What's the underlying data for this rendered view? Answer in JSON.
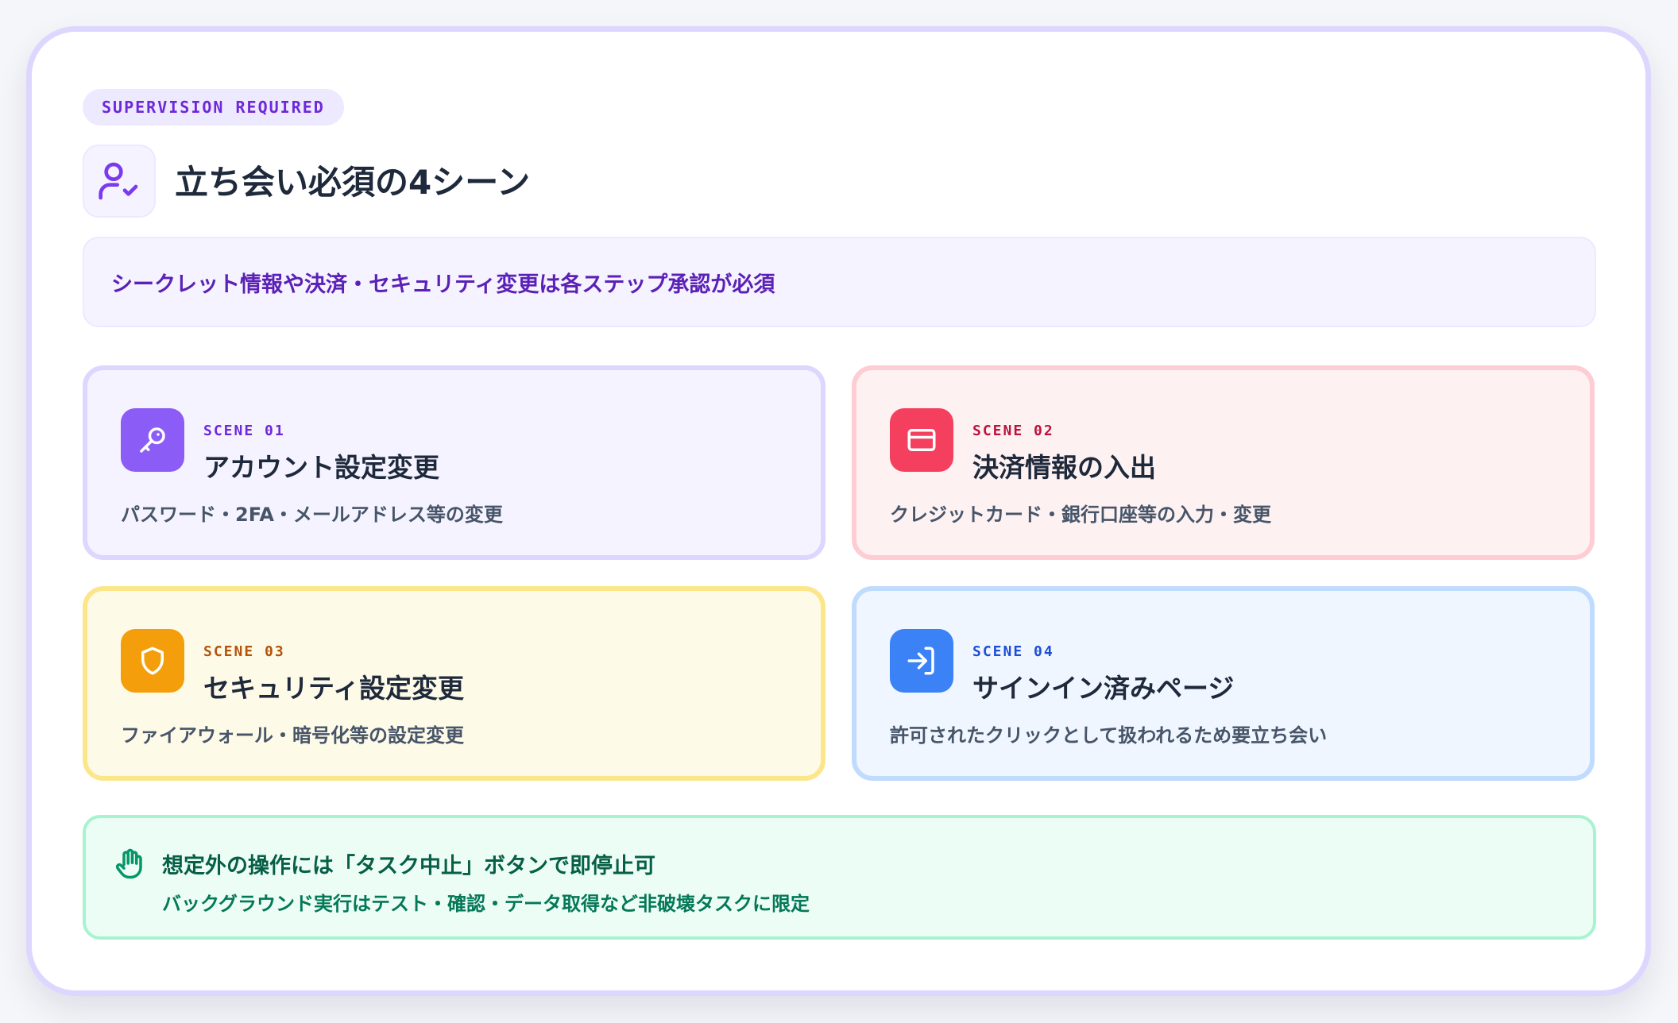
{
  "header": {
    "badge": "SUPERVISION REQUIRED",
    "title": "立ち会い必須の4シーン",
    "title_icon": "user-check-icon"
  },
  "notice": {
    "text": "シークレット情報や決済・セキュリティ変更は各ステップ承認が必須"
  },
  "scenes": [
    {
      "label": "SCENE 01",
      "title": "アカウント設定変更",
      "description": "パスワード・2FA・メールアドレス等の変更",
      "icon": "key-icon",
      "accent": "#8b5cf6"
    },
    {
      "label": "SCENE 02",
      "title": "決済情報の入出",
      "description": "クレジットカード・銀行口座等の入力・変更",
      "icon": "credit-card-icon",
      "accent": "#f43f5e"
    },
    {
      "label": "SCENE 03",
      "title": "セキュリティ設定変更",
      "description": "ファイアウォール・暗号化等の設定変更",
      "icon": "shield-icon",
      "accent": "#f59e0b"
    },
    {
      "label": "SCENE 04",
      "title": "サインイン済みページ",
      "description": "許可されたクリックとして扱われるため要立ち会い",
      "icon": "sign-in-icon",
      "accent": "#3b82f6"
    }
  ],
  "footer": {
    "icon": "hand-stop-icon",
    "main": "想定外の操作には「タスク中止」ボタンで即停止可",
    "sub": "バックグラウンド実行はテスト・確認・データ取得など非破壊タスクに限定"
  }
}
